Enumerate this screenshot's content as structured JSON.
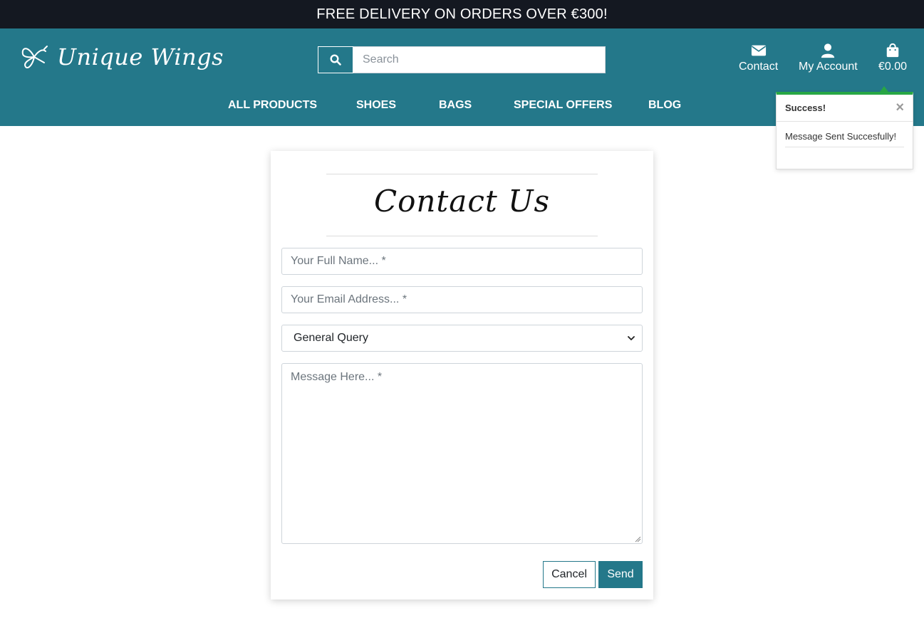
{
  "banner": {
    "text": "FREE DELIVERY ON ORDERS OVER €300!"
  },
  "brand": {
    "name": "Unique Wings",
    "logo_icon": "butterfly-icon"
  },
  "search": {
    "placeholder": "Search",
    "icon": "search-icon"
  },
  "header_links": [
    {
      "label": "Contact",
      "icon": "envelope-icon"
    },
    {
      "label": "My Account",
      "icon": "user-icon"
    },
    {
      "label": "€0.00",
      "icon": "shopping-bag-icon"
    }
  ],
  "nav": {
    "items": [
      {
        "label": "ALL PRODUCTS"
      },
      {
        "label": "SHOES"
      },
      {
        "label": "BAGS"
      },
      {
        "label": "SPECIAL OFFERS"
      },
      {
        "label": "BLOG"
      }
    ]
  },
  "toast": {
    "title": "Success!",
    "close": "×",
    "message": "Message Sent Succesfully!"
  },
  "contact_form": {
    "title": "Contact Us",
    "name_placeholder": "Your Full Name... *",
    "email_placeholder": "Your Email Address... *",
    "query_type": {
      "selected": "General Query"
    },
    "message_placeholder": "Message Here... *",
    "cancel_label": "Cancel",
    "send_label": "Send"
  },
  "colors": {
    "banner_bg": "#141821",
    "header_bg": "#24788a",
    "accent": "#24788a",
    "success": "#28a745"
  }
}
